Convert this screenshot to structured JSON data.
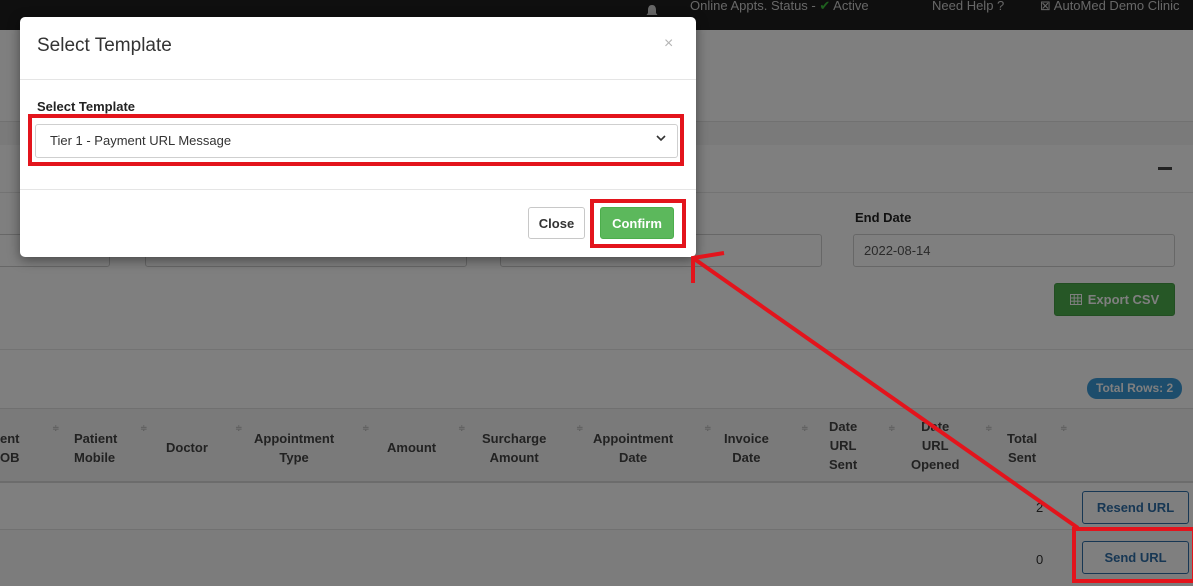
{
  "topbar": {
    "status_prefix": "Online Appts. Status - ",
    "status_mark": "✔",
    "status_value": "Active",
    "help": "Need Help ?",
    "clinic": "⊠ AutoMed Demo Clinic"
  },
  "filters": {
    "end_date_label": "End Date",
    "end_date_value": "2022-08-14",
    "export_label": "Export CSV"
  },
  "table": {
    "total_rows": "Total Rows: 2",
    "headers": [
      {
        "line1": "ent",
        "line2": "OB"
      },
      {
        "line1": "Patient",
        "line2": "Mobile"
      },
      {
        "line1": "Doctor",
        "line2": ""
      },
      {
        "line1": "Appointment",
        "line2": "Type"
      },
      {
        "line1": "Amount",
        "line2": ""
      },
      {
        "line1": "Surcharge",
        "line2": "Amount"
      },
      {
        "line1": "Appointment",
        "line2": "Date"
      },
      {
        "line1": "Invoice",
        "line2": "Date"
      },
      {
        "line1": "Date",
        "line2": "URL",
        "line3": "Sent"
      },
      {
        "line1": "Date",
        "line2": "URL",
        "line3": "Opened"
      },
      {
        "line1": "Total",
        "line2": "Sent"
      }
    ],
    "rows": [
      {
        "total_sent": "2",
        "action": "Resend URL"
      },
      {
        "total_sent": "0",
        "action": "Send URL"
      }
    ]
  },
  "modal": {
    "title": "Select Template",
    "close_x": "×",
    "field_label": "Select Template",
    "selected_template": "Tier 1 - Payment URL Message",
    "close_button": "Close",
    "confirm_button": "Confirm"
  },
  "colors": {
    "highlight": "#e3141c",
    "confirm_green": "#5cb85c",
    "link_blue": "#2f6fa8",
    "badge_blue": "#3a9ad9"
  }
}
